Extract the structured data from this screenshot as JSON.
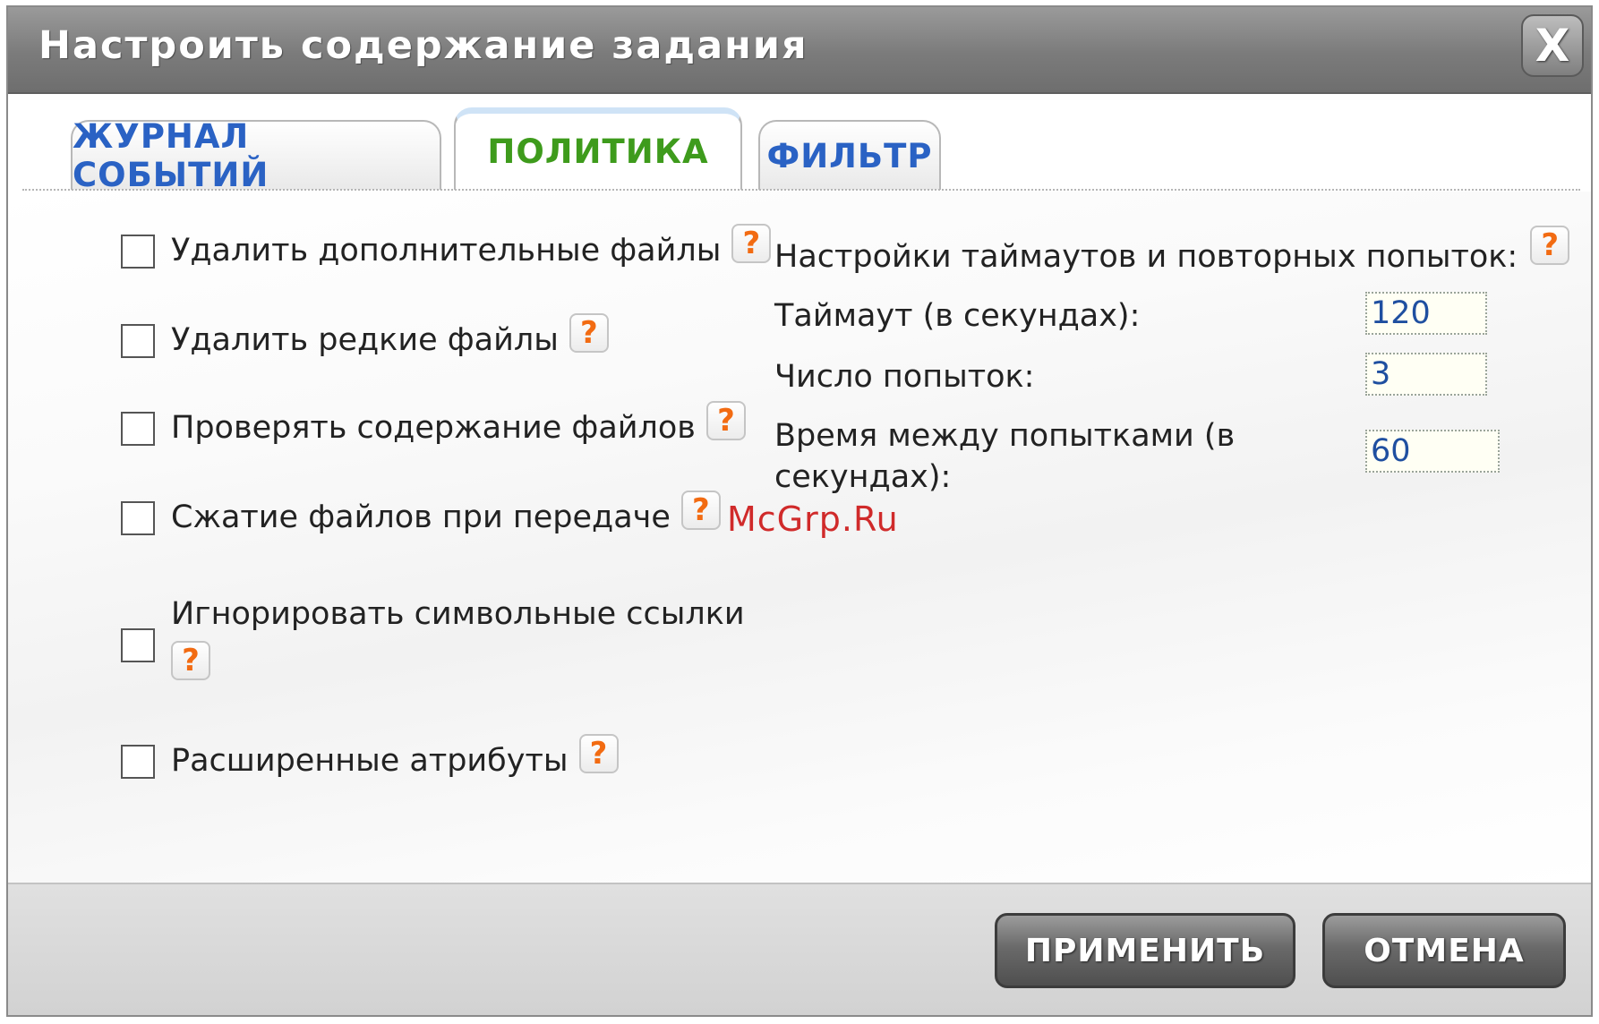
{
  "dialog": {
    "title": "Настроить содержание задания",
    "close_label": "X"
  },
  "tabs": [
    {
      "label": "ЖУРНАЛ СОБЫТИЙ",
      "active": false
    },
    {
      "label": "ПОЛИТИКА",
      "active": true
    },
    {
      "label": "ФИЛЬТР",
      "active": false
    }
  ],
  "options": [
    {
      "label": "Удалить дополнительные файлы",
      "checked": false
    },
    {
      "label": "Удалить редкие файлы",
      "checked": false
    },
    {
      "label": "Проверять содержание файлов",
      "checked": false
    },
    {
      "label": "Сжатие файлов при передаче",
      "checked": false
    },
    {
      "label": "Игнорировать символьные ссылки",
      "checked": false
    },
    {
      "label": "Расширенные атрибуты",
      "checked": false
    }
  ],
  "help_icon": {
    "glyph": "?",
    "icon": "help-icon",
    "color": "#f26b12"
  },
  "timeouts": {
    "heading": "Настройки таймаутов и повторных попыток:",
    "timeout_label": "Таймаут (в секундах):",
    "timeout_value": "120",
    "attempts_label": "Число попыток:",
    "attempts_value": "3",
    "interval_label_line1": "Время между попытками (в",
    "interval_label_line2": "секундах):",
    "interval_value": "60"
  },
  "watermark": "McGrp.Ru",
  "footer": {
    "apply_label": "ПРИМЕНИТЬ",
    "cancel_label": "ОТМЕНА"
  },
  "colors": {
    "tab_inactive": "#2a62c4",
    "tab_active": "#3e9b1c",
    "input_text": "#1f4fa0",
    "watermark": "#d02a2a"
  }
}
